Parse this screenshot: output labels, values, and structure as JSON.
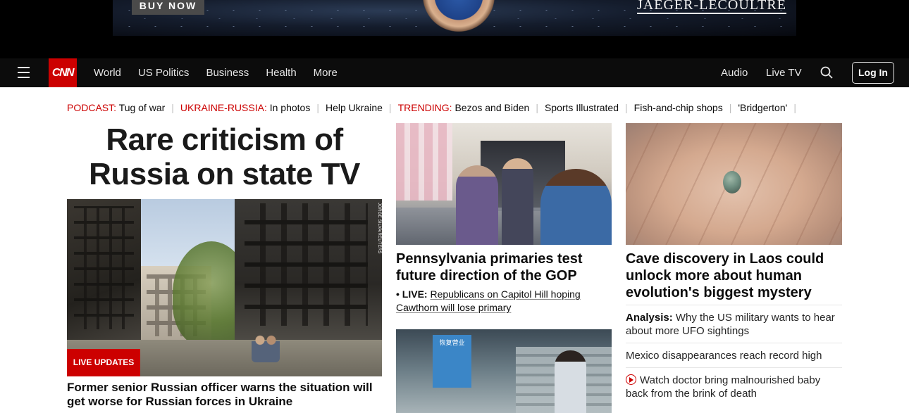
{
  "ad": {
    "buy_label": "BUY NOW",
    "brand": "JAEGER-LECOULTRE"
  },
  "nav": {
    "logo": "CNN",
    "links": [
      "World",
      "US Politics",
      "Business",
      "Health",
      "More"
    ],
    "audio": "Audio",
    "live_tv": "Live TV",
    "login": "Log In"
  },
  "trending": [
    {
      "label": "PODCAST:",
      "text": "Tug of war"
    },
    {
      "label": "UKRAINE-RUSSIA:",
      "text": "In photos"
    },
    {
      "label": "",
      "text": "Help Ukraine"
    },
    {
      "label": "TRENDING:",
      "text": "Bezos and Biden"
    },
    {
      "label": "",
      "text": "Sports Illustrated"
    },
    {
      "label": "",
      "text": "Fish-and-chip shops"
    },
    {
      "label": "",
      "text": "'Bridgerton'"
    }
  ],
  "hero": {
    "title": "Rare criticism of Russia on state TV",
    "photo_credit": "JORGE SILVA/REUTERS",
    "badge": "LIVE UPDATES",
    "caption": "Former senior Russian officer warns the situation will get worse for Russian forces in Ukraine"
  },
  "middle": {
    "headline": "Pennsylvania primaries test future direction of the GOP",
    "live_prefix": "• LIVE:",
    "live_text": "Republicans on Capitol Hill hoping Cawthorn will lose primary",
    "sign_text": "恢复营业"
  },
  "right": {
    "headline": "Cave discovery in Laos could unlock more about human evolution's biggest mystery",
    "items": [
      {
        "prefix": "Analysis:",
        "text": "Why the US military wants to hear about more UFO sightings"
      },
      {
        "prefix": "",
        "text": "Mexico disappearances reach record high"
      },
      {
        "prefix": "",
        "text": "Watch doctor bring malnourished baby back from the brink of death",
        "icon": "play-icon"
      }
    ]
  },
  "colors": {
    "brand_red": "#cc0000",
    "nav_bg": "#0c0c0c"
  }
}
